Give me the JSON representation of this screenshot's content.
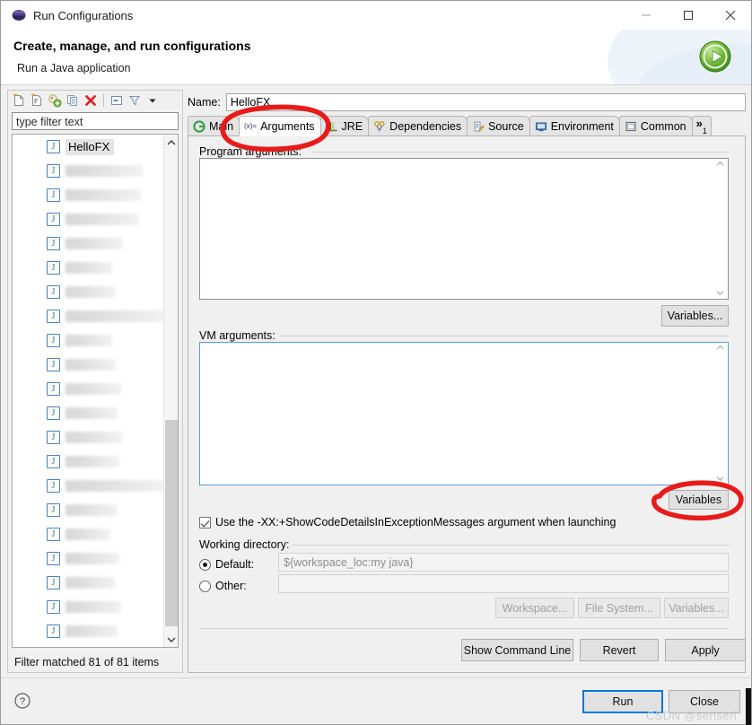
{
  "window": {
    "title": "Run Configurations",
    "icon": "eclipse-icon",
    "minimize": "minimize-icon",
    "maximize": "maximize-icon",
    "close": "close-icon"
  },
  "header": {
    "title": "Create, manage, and run configurations",
    "subtitle": "Run a Java application",
    "badge_icon": "run-play-icon"
  },
  "left_pane": {
    "toolbar": [
      {
        "name": "new-configuration-icon",
        "title": "New launch configuration"
      },
      {
        "name": "new-prototype-icon",
        "title": "New prototype"
      },
      {
        "name": "export-configuration-icon",
        "title": "Export"
      },
      {
        "name": "duplicate-configuration-icon",
        "title": "Duplicate"
      },
      {
        "name": "delete-configuration-icon",
        "title": "Delete"
      },
      {
        "name": "collapse-all-icon",
        "title": "Collapse All"
      },
      {
        "name": "filter-icon",
        "title": "Filter"
      },
      {
        "name": "view-menu-icon",
        "title": "View Menu"
      }
    ],
    "filter_placeholder": "type filter text",
    "filter_value": "",
    "selected_item": "HelloFX",
    "hidden_item_count": 20,
    "status": "Filter matched 81 of 81 items",
    "scroll_up": "scroll-up-icon",
    "scroll_down": "scroll-down-icon"
  },
  "right_pane": {
    "name_label": "Name:",
    "name_value": "HelloFX",
    "tabs": [
      {
        "label": "Main",
        "icon": "main-tab-icon",
        "active": false
      },
      {
        "label": "Arguments",
        "icon": "arguments-tab-icon",
        "active": true
      },
      {
        "label": "JRE",
        "icon": "jre-tab-icon",
        "active": false
      },
      {
        "label": "Dependencies",
        "icon": "dependencies-tab-icon",
        "active": false
      },
      {
        "label": "Source",
        "icon": "source-tab-icon",
        "active": false
      },
      {
        "label": "Environment",
        "icon": "environment-tab-icon",
        "active": false
      },
      {
        "label": "Common",
        "icon": "common-tab-icon",
        "active": false
      }
    ],
    "tab_overflow": "»",
    "tab_overflow_count": "1",
    "program_arguments": {
      "label": "Program arguments:",
      "value": "",
      "variables_button": "Variables..."
    },
    "vm_arguments": {
      "label": "VM arguments:",
      "value": "",
      "variables_button": "Variables"
    },
    "show_code_details": {
      "label": "Use the -XX:+ShowCodeDetailsInExceptionMessages argument when launching",
      "checked": true
    },
    "working_directory": {
      "label": "Working directory:",
      "default_label": "Default:",
      "default_value": "${workspace_loc:my java}",
      "default_selected": true,
      "other_label": "Other:",
      "other_value": "",
      "other_selected": false,
      "workspace_button": "Workspace...",
      "file_system_button": "File System...",
      "variables_button": "Variables..."
    },
    "actions": {
      "show_command_line": "Show Command Line",
      "revert": "Revert",
      "apply": "Apply"
    }
  },
  "footer": {
    "help_icon": "help-icon",
    "run_button": "Run",
    "close_button": "Close"
  },
  "watermark": "CSDN @seriseri",
  "colors": {
    "accent": "#0078d7",
    "annotation": "#e81b1b",
    "focus_border": "#5b9bd5",
    "dialog_bg": "#f0f0f0"
  }
}
